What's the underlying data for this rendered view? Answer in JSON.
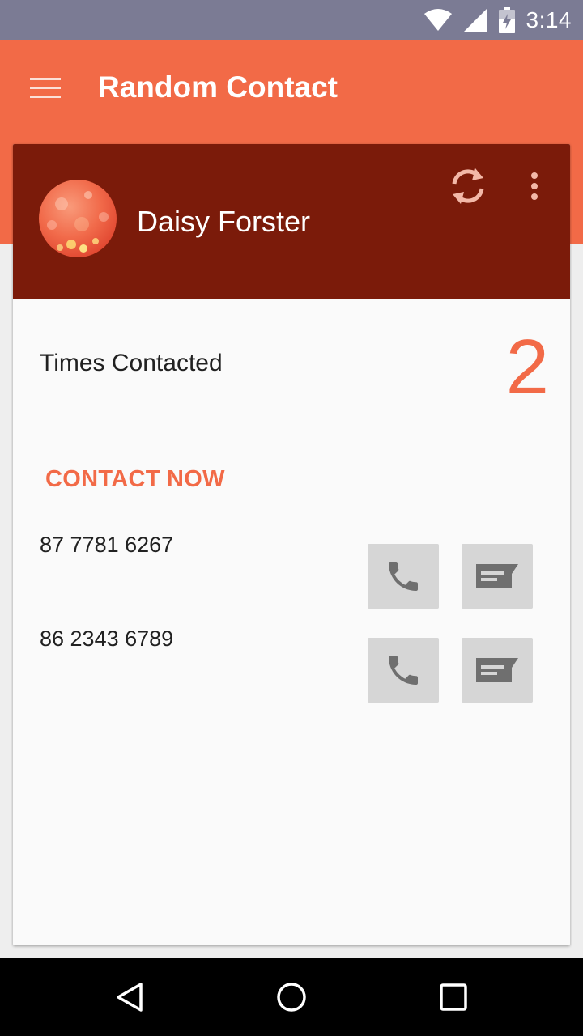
{
  "status_bar": {
    "time": "3:14",
    "icons": [
      "wifi-icon",
      "cell-signal-icon",
      "battery-icon"
    ]
  },
  "app_bar": {
    "title": "Random Contact",
    "menu_icon": "hamburger-menu-icon",
    "color": "#f26a47"
  },
  "contact_card": {
    "header_color": "#7b1b0a",
    "name": "Daisy Forster",
    "refresh_icon": "refresh-icon",
    "overflow_icon": "more-vert-icon",
    "times_contacted_label": "Times Contacted",
    "times_contacted_value": "2",
    "contact_now_label": "CONTACT NOW",
    "phones": [
      {
        "number": "87 7781 6267",
        "call_icon": "phone-icon",
        "message_icon": "message-icon"
      },
      {
        "number": "86 2343 6789",
        "call_icon": "phone-icon",
        "message_icon": "message-icon"
      }
    ]
  },
  "nav_bar": {
    "items": [
      "back-icon",
      "home-icon",
      "recents-icon"
    ]
  }
}
